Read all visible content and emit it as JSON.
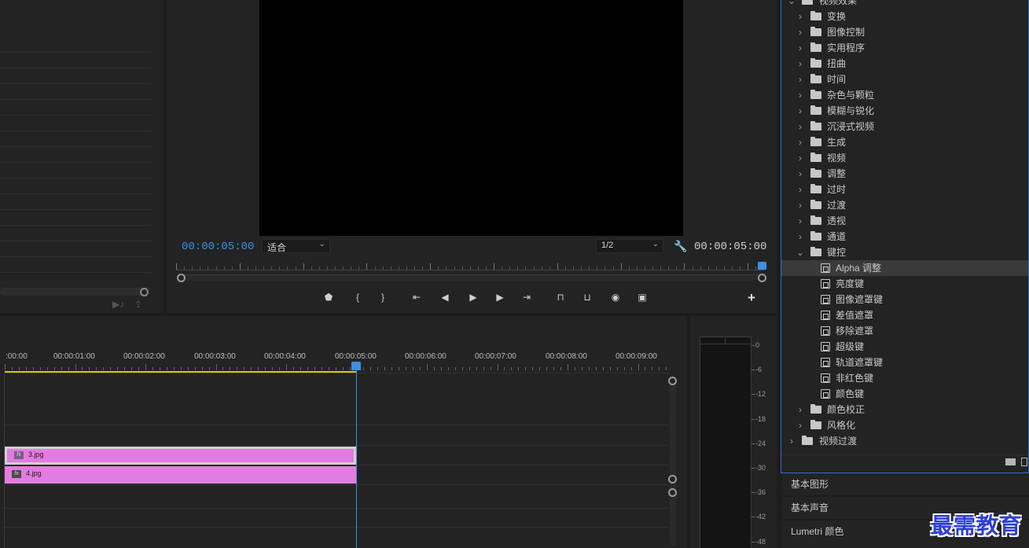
{
  "program_monitor": {
    "current_timecode": "00:00:05:00",
    "duration_timecode": "00:00:05:00",
    "zoom_select": "适合",
    "resolution_select": "1/2",
    "controls": [
      {
        "name": "add-marker-button",
        "glyph": "⬟"
      },
      {
        "name": "mark-in-button",
        "glyph": "{"
      },
      {
        "name": "mark-out-button",
        "glyph": "}"
      },
      {
        "name": "go-to-in-button",
        "glyph": "⇤"
      },
      {
        "name": "step-back-button",
        "glyph": "◀"
      },
      {
        "name": "play-button",
        "glyph": "▶"
      },
      {
        "name": "step-forward-button",
        "glyph": "▶"
      },
      {
        "name": "go-to-out-button",
        "glyph": "⇥"
      },
      {
        "name": "lift-button",
        "glyph": "⊓"
      },
      {
        "name": "extract-button",
        "glyph": "⊔"
      },
      {
        "name": "export-frame-button",
        "glyph": "◉"
      },
      {
        "name": "compare-view-button",
        "glyph": "▣"
      }
    ]
  },
  "timeline": {
    "ruler_labels": [
      ":00:00",
      "00:00:01:00",
      "00:00:02:00",
      "00:00:03:00",
      "00:00:04:00",
      "00:00:05:00",
      "00:00:06:00",
      "00:00:07:00",
      "00:00:08:00",
      "00:00:09:00"
    ],
    "clips": [
      {
        "name": "3.jpg",
        "fx": "fx"
      },
      {
        "name": "4.jpg",
        "fx": "fx"
      }
    ]
  },
  "audio_meter": {
    "labels": [
      "0",
      "-6",
      "-12",
      "-18",
      "-24",
      "-30",
      "-36",
      "-42",
      "-48"
    ]
  },
  "effects": {
    "tree": [
      {
        "label": "视频效果",
        "level": 0,
        "type": "folder",
        "open": true
      },
      {
        "label": "变换",
        "level": 1,
        "type": "folder"
      },
      {
        "label": "图像控制",
        "level": 1,
        "type": "folder"
      },
      {
        "label": "实用程序",
        "level": 1,
        "type": "folder"
      },
      {
        "label": "扭曲",
        "level": 1,
        "type": "folder"
      },
      {
        "label": "时间",
        "level": 1,
        "type": "folder"
      },
      {
        "label": "杂色与颗粒",
        "level": 1,
        "type": "folder"
      },
      {
        "label": "模糊与锐化",
        "level": 1,
        "type": "folder"
      },
      {
        "label": "沉浸式视频",
        "level": 1,
        "type": "folder"
      },
      {
        "label": "生成",
        "level": 1,
        "type": "folder"
      },
      {
        "label": "视频",
        "level": 1,
        "type": "folder"
      },
      {
        "label": "调整",
        "level": 1,
        "type": "folder"
      },
      {
        "label": "过时",
        "level": 1,
        "type": "folder"
      },
      {
        "label": "过渡",
        "level": 1,
        "type": "folder"
      },
      {
        "label": "透视",
        "level": 1,
        "type": "folder"
      },
      {
        "label": "通道",
        "level": 1,
        "type": "folder"
      },
      {
        "label": "键控",
        "level": 1,
        "type": "folder",
        "open": true
      },
      {
        "label": "Alpha 调整",
        "level": 2,
        "type": "effect",
        "selected": true
      },
      {
        "label": "亮度键",
        "level": 2,
        "type": "effect"
      },
      {
        "label": "图像遮罩键",
        "level": 2,
        "type": "effect"
      },
      {
        "label": "差值遮罩",
        "level": 2,
        "type": "effect"
      },
      {
        "label": "移除遮罩",
        "level": 2,
        "type": "effect"
      },
      {
        "label": "超级键",
        "level": 2,
        "type": "effect"
      },
      {
        "label": "轨道遮罩键",
        "level": 2,
        "type": "effect"
      },
      {
        "label": "非红色键",
        "level": 2,
        "type": "effect"
      },
      {
        "label": "颜色键",
        "level": 2,
        "type": "effect"
      },
      {
        "label": "颜色校正",
        "level": 1,
        "type": "folder"
      },
      {
        "label": "风格化",
        "level": 1,
        "type": "folder"
      },
      {
        "label": "视频过渡",
        "level": 0,
        "type": "folder"
      }
    ]
  },
  "side_panels": {
    "essential_graphics": "基本图形",
    "essential_sound": "基本声音",
    "lumetri_color": "Lumetri 颜色"
  },
  "watermark": "最需教育",
  "colors": {
    "accent_blue": "#3d8fe5",
    "clip_pink": "#e37ce0",
    "work_area_yellow": "#d9c42d",
    "panel_bg": "#232323"
  }
}
